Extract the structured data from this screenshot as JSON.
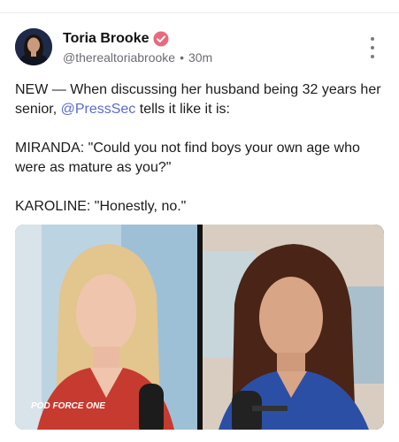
{
  "author": {
    "name": "Toria Brooke",
    "handle": "@therealtoriabrooke",
    "separator": "•",
    "time": "30m",
    "verified_color": "#e86a7b"
  },
  "post": {
    "line1_prefix": "NEW — When discussing her husband being 32 years her senior, ",
    "mention": "@PressSec",
    "line1_suffix": " tells it like it is:",
    "quote1": "MIRANDA: \"Could you not find boys your own age who were as mature as you?\"",
    "quote2": "KAROLINE: \"Honestly, no.\""
  },
  "media": {
    "logo_text": "POD FORCE ONE"
  },
  "colors": {
    "mention": "#5b6ad0",
    "text": "#1c1c1e",
    "secondary": "#6b6b74"
  }
}
